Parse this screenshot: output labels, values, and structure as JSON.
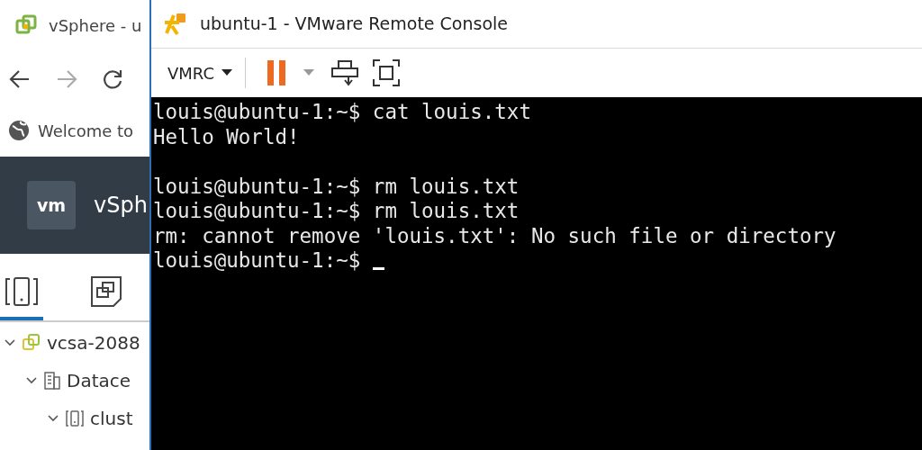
{
  "browser": {
    "tab_title": "vSphere - u",
    "address": "Welcome to",
    "header": {
      "logo": "vm",
      "title": "vSph"
    },
    "nav_tabs": [
      {
        "kind": "hosts",
        "selected": true
      },
      {
        "kind": "vms",
        "selected": false
      }
    ],
    "tree": [
      {
        "kind": "vcenter",
        "label": "vcsa-2088",
        "expanded": true,
        "children": [
          {
            "kind": "datacenter",
            "label": "Datace",
            "expanded": true,
            "children": [
              {
                "kind": "cluster",
                "label": "clust",
                "expanded": true
              }
            ]
          }
        ]
      }
    ]
  },
  "vmrc": {
    "title": "ubuntu-1 - VMware Remote Console",
    "menu": "VMRC",
    "terminal_lines": [
      {
        "kind": "text",
        "text": "louis@ubuntu-1:~$ cat louis.txt"
      },
      {
        "kind": "text",
        "text": "Hello World!"
      },
      {
        "kind": "blank"
      },
      {
        "kind": "text",
        "text": "louis@ubuntu-1:~$ rm louis.txt"
      },
      {
        "kind": "text",
        "text": "louis@ubuntu-1:~$ rm louis.txt"
      },
      {
        "kind": "text",
        "text": "rm: cannot remove 'louis.txt': No such file or directory"
      },
      {
        "kind": "text",
        "text": "louis@ubuntu-1:~$"
      }
    ],
    "cursor_visible": true
  }
}
